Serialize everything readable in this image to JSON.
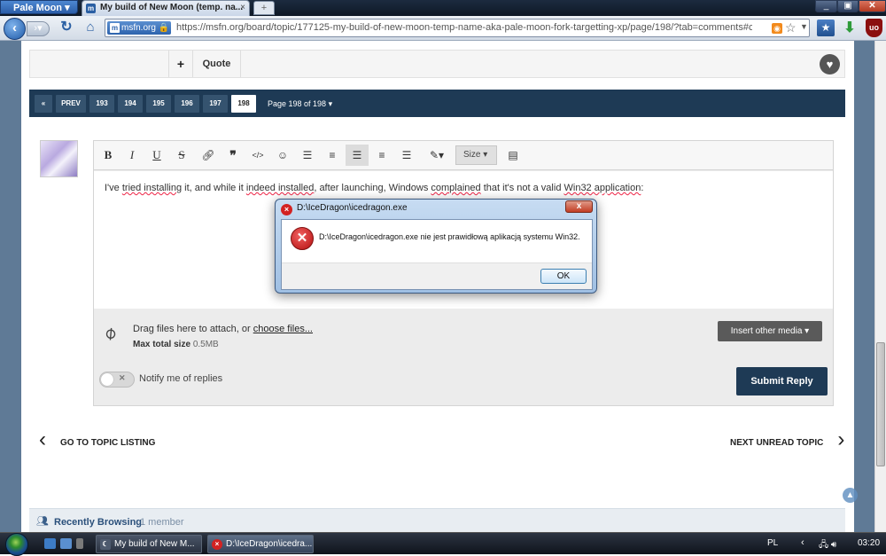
{
  "browser": {
    "app_menu_label": "Pale Moon",
    "tab_title": "My build of New Moon (temp. na...",
    "tab_favicon": "m",
    "tab_close": "×",
    "new_tab": "+",
    "identity_label": "msfn.org",
    "url": "https://msfn.org/board/topic/177125-my-build-of-new-moon-temp-name-aka-pale-moon-fork-targetting-xp/page/198/?tab=comments#comment-1171779",
    "uo_label": "uo"
  },
  "post_controls": {
    "plus_label": "+",
    "quote_label": "Quote"
  },
  "pagination": {
    "first": "«",
    "prev": "PREV",
    "pages": [
      "193",
      "194",
      "195",
      "196",
      "197",
      "198"
    ],
    "current": "198",
    "info": "Page 198 of 198"
  },
  "editor": {
    "toolbar": {
      "bold": "B",
      "italic": "I",
      "underline": "U",
      "strike": "S",
      "size_label": "Size"
    },
    "text_parts": [
      "I've ",
      "tried installing",
      " it, and while it ",
      "indeed installed",
      ", after launching, Windows ",
      "complained",
      " that it's not a valid ",
      "Win32 application",
      ":"
    ]
  },
  "attachments": {
    "drag_text": "Drag files here to attach, or ",
    "choose_link": "choose files...",
    "max_label": "Max total size",
    "max_value": "0.5MB",
    "insert_media": "Insert other media"
  },
  "notify": {
    "label": "Notify me of replies",
    "enabled": false
  },
  "submit_label": "Submit Reply",
  "topic_nav": {
    "back": "GO TO TOPIC LISTING",
    "next": "NEXT UNREAD TOPIC"
  },
  "recently_browsing": {
    "label": "Recently Browsing",
    "count": "1 member"
  },
  "dialog": {
    "title": "D:\\IceDragon\\icedragon.exe",
    "message": "D:\\IceDragon\\icedragon.exe nie jest prawidłową aplikacją systemu Win32.",
    "ok_label": "OK",
    "close": "x"
  },
  "taskbar": {
    "tasks": [
      {
        "label": "My build of New M..."
      },
      {
        "label": "D:\\IceDragon\\icedra..."
      }
    ],
    "language": "PL",
    "clock": "03:20"
  },
  "colors": {
    "nav_dark": "#1e3a55",
    "error_red": "#d32222"
  }
}
